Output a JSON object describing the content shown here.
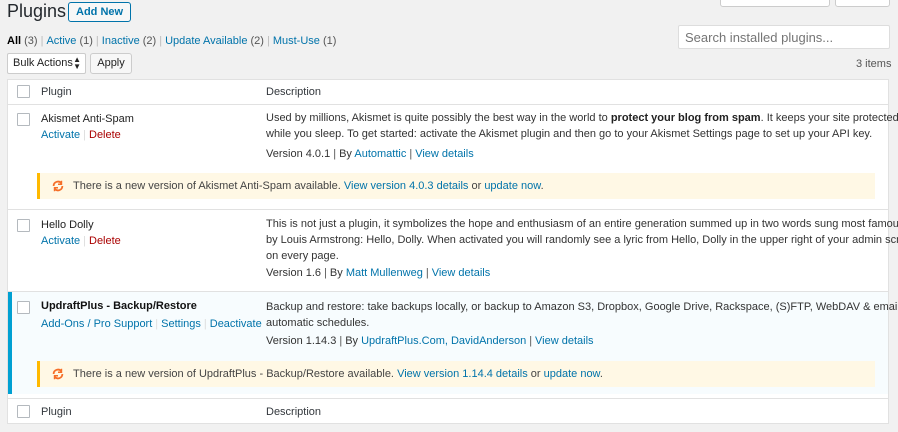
{
  "page": {
    "title": "Plugins",
    "add_new": "Add New"
  },
  "filters": [
    {
      "label": "All",
      "count": "(3)"
    },
    {
      "label": "Active",
      "count": "(1)"
    },
    {
      "label": "Inactive",
      "count": "(2)"
    },
    {
      "label": "Update Available",
      "count": "(2)"
    },
    {
      "label": "Must-Use",
      "count": "(1)"
    }
  ],
  "search": {
    "placeholder": "Search installed plugins..."
  },
  "bulk": {
    "selected": "Bulk Actions",
    "apply": "Apply",
    "items_count": "3 items"
  },
  "table": {
    "col_plugin": "Plugin",
    "col_description": "Description"
  },
  "plugins": [
    {
      "name": "Akismet Anti-Spam",
      "actions": [
        "Activate",
        "Delete"
      ],
      "desc_line1_pre": "Used by millions, Akismet is quite possibly the best way in the world to ",
      "desc_line1_bold": "protect your blog from spam",
      "desc_line1_post": ". It keeps your site protected even",
      "desc_line2": "while you sleep. To get started: activate the Akismet plugin and then go to your Akismet Settings page to set up your API key.",
      "version": "Version 4.0.1",
      "by": "By",
      "author": "Automattic",
      "details": "View details",
      "update_pre": "There is a new version of Akismet Anti-Spam available.",
      "update_link": "View version 4.0.3 details",
      "update_or": "or",
      "update_now": "update now",
      "update_end": "."
    },
    {
      "name": "Hello Dolly",
      "actions": [
        "Activate",
        "Delete"
      ],
      "desc_line1": "This is not just a plugin, it symbolizes the hope and enthusiasm of an entire generation summed up in two words sung most famously",
      "desc_line2": "by Louis Armstrong: Hello, Dolly. When activated you will randomly see a lyric from Hello, Dolly in the upper right of your admin screen",
      "desc_line3": "on every page.",
      "version": "Version 1.6",
      "by": "By",
      "author": "Matt Mullenweg",
      "details": "View details"
    },
    {
      "name": "UpdraftPlus - Backup/Restore",
      "actions": [
        "Add-Ons / Pro Support",
        "Settings",
        "Deactivate"
      ],
      "desc_line1": "Backup and restore: take backups locally, or backup to Amazon S3, Dropbox, Google Drive, Rackspace, (S)FTP, WebDAV & email, on",
      "desc_line2": "automatic schedules.",
      "version": "Version 1.14.3",
      "by": "By",
      "author": "UpdraftPlus.Com, DavidAnderson",
      "details": "View details",
      "update_pre": "There is a new version of UpdraftPlus - Backup/Restore available.",
      "update_link": "View version 1.14.4 details",
      "update_or": "or",
      "update_now": "update now",
      "update_end": "."
    }
  ],
  "colors": {
    "accent": "#0073aa",
    "active_border": "#00a0d2",
    "notice_border": "#ffb900",
    "notice_bg": "#fff8e5",
    "delete": "#aa0000"
  }
}
